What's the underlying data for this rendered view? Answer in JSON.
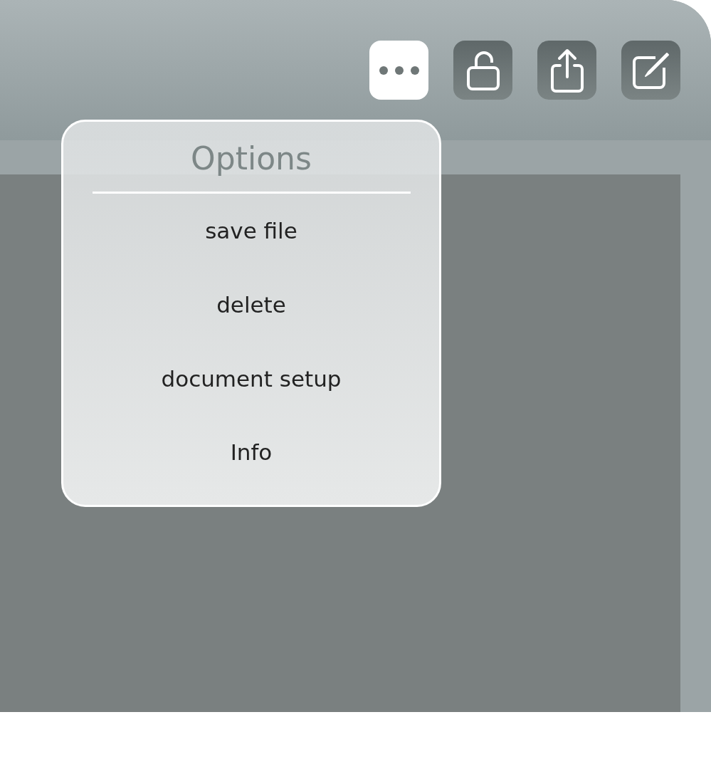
{
  "toolbar": {
    "buttons": [
      {
        "kind": "more",
        "selected": true
      },
      {
        "kind": "unlock",
        "selected": false
      },
      {
        "kind": "share",
        "selected": false
      },
      {
        "kind": "edit",
        "selected": false
      }
    ]
  },
  "menu": {
    "title": "Options",
    "items": [
      "save file",
      "delete",
      "document setup",
      "Info"
    ]
  }
}
